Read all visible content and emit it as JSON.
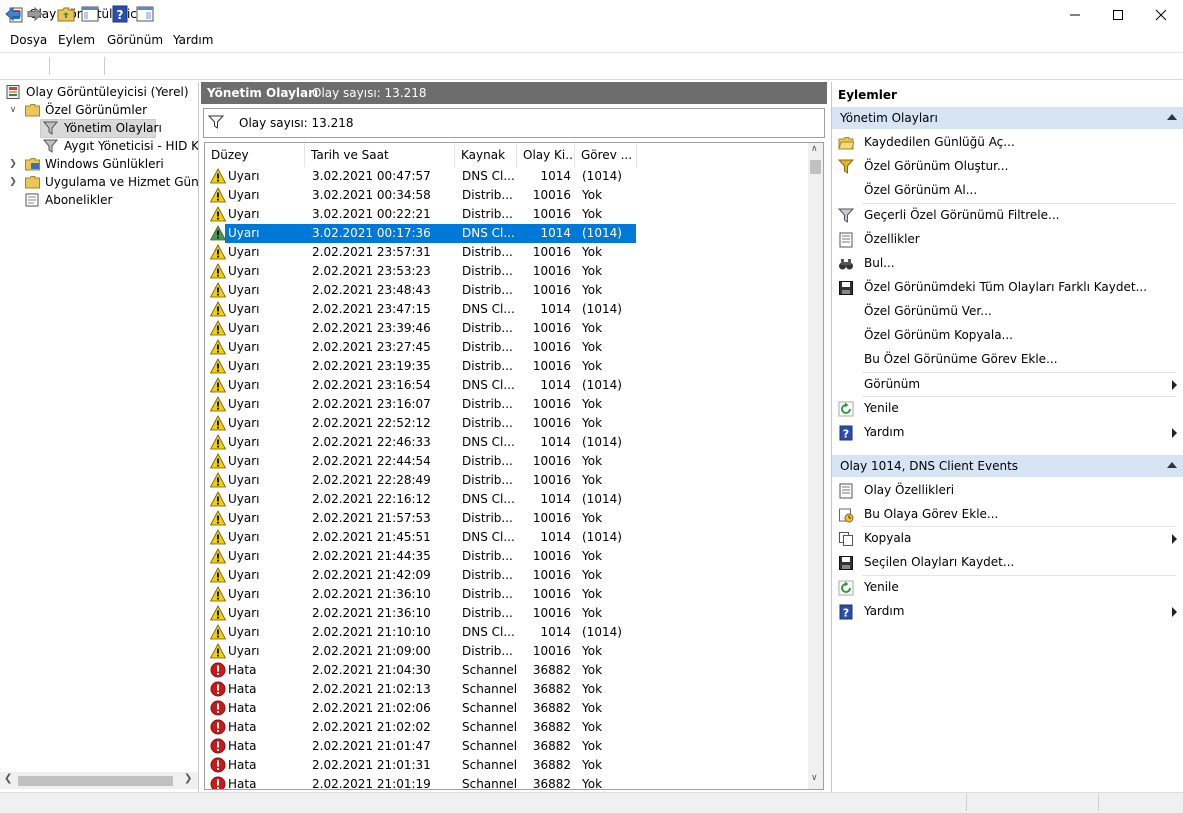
{
  "window": {
    "title": "Olay Görüntüleyicisi"
  },
  "menu": [
    {
      "label": "Dosya"
    },
    {
      "label": "Eylem"
    },
    {
      "label": "Görünüm"
    },
    {
      "label": "Yardım"
    }
  ],
  "tree": {
    "items": [
      {
        "label": "Olay Görüntüleyicisi (Yerel)",
        "icon": "event-viewer-icon"
      },
      {
        "label": "Özel Görünümler",
        "icon": "folder-icon"
      },
      {
        "label": "Yönetim Olayları",
        "icon": "filter-icon"
      },
      {
        "label": "Aygıt Yöneticisi - HID Kla",
        "icon": "filter-icon"
      },
      {
        "label": "Windows Günlükleri",
        "icon": "folder-icon"
      },
      {
        "label": "Uygulama ve Hizmet Günlük",
        "icon": "folder-icon"
      },
      {
        "label": "Abonelikler",
        "icon": "subscriptions-icon"
      }
    ]
  },
  "center": {
    "title": "Yönetim Olayları",
    "count_label": "Olay sayısı: 13.218",
    "filter_count": "Olay sayısı: 13.218",
    "columns": [
      "Düzey",
      "Tarih ve Saat",
      "Kaynak",
      "Olay Ki...",
      "Görev ..."
    ],
    "rows": [
      {
        "level": "Uyarı",
        "type": "warning",
        "date": "3.02.2021 00:47:57",
        "source": "DNS Cl...",
        "id": "1014",
        "task": "(1014)"
      },
      {
        "level": "Uyarı",
        "type": "warning",
        "date": "3.02.2021 00:34:58",
        "source": "Distrib...",
        "id": "10016",
        "task": "Yok"
      },
      {
        "level": "Uyarı",
        "type": "warning",
        "date": "3.02.2021 00:22:21",
        "source": "Distrib...",
        "id": "10016",
        "task": "Yok"
      },
      {
        "level": "Uyarı",
        "type": "warning",
        "date": "3.02.2021 00:17:36",
        "source": "DNS Cl...",
        "id": "1014",
        "task": "(1014)",
        "selected": true
      },
      {
        "level": "Uyarı",
        "type": "warning",
        "date": "2.02.2021 23:57:31",
        "source": "Distrib...",
        "id": "10016",
        "task": "Yok"
      },
      {
        "level": "Uyarı",
        "type": "warning",
        "date": "2.02.2021 23:53:23",
        "source": "Distrib...",
        "id": "10016",
        "task": "Yok"
      },
      {
        "level": "Uyarı",
        "type": "warning",
        "date": "2.02.2021 23:48:43",
        "source": "Distrib...",
        "id": "10016",
        "task": "Yok"
      },
      {
        "level": "Uyarı",
        "type": "warning",
        "date": "2.02.2021 23:47:15",
        "source": "DNS Cl...",
        "id": "1014",
        "task": "(1014)"
      },
      {
        "level": "Uyarı",
        "type": "warning",
        "date": "2.02.2021 23:39:46",
        "source": "Distrib...",
        "id": "10016",
        "task": "Yok"
      },
      {
        "level": "Uyarı",
        "type": "warning",
        "date": "2.02.2021 23:27:45",
        "source": "Distrib...",
        "id": "10016",
        "task": "Yok"
      },
      {
        "level": "Uyarı",
        "type": "warning",
        "date": "2.02.2021 23:19:35",
        "source": "Distrib...",
        "id": "10016",
        "task": "Yok"
      },
      {
        "level": "Uyarı",
        "type": "warning",
        "date": "2.02.2021 23:16:54",
        "source": "DNS Cl...",
        "id": "1014",
        "task": "(1014)"
      },
      {
        "level": "Uyarı",
        "type": "warning",
        "date": "2.02.2021 23:16:07",
        "source": "Distrib...",
        "id": "10016",
        "task": "Yok"
      },
      {
        "level": "Uyarı",
        "type": "warning",
        "date": "2.02.2021 22:52:12",
        "source": "Distrib...",
        "id": "10016",
        "task": "Yok"
      },
      {
        "level": "Uyarı",
        "type": "warning",
        "date": "2.02.2021 22:46:33",
        "source": "DNS Cl...",
        "id": "1014",
        "task": "(1014)"
      },
      {
        "level": "Uyarı",
        "type": "warning",
        "date": "2.02.2021 22:44:54",
        "source": "Distrib...",
        "id": "10016",
        "task": "Yok"
      },
      {
        "level": "Uyarı",
        "type": "warning",
        "date": "2.02.2021 22:28:49",
        "source": "Distrib...",
        "id": "10016",
        "task": "Yok"
      },
      {
        "level": "Uyarı",
        "type": "warning",
        "date": "2.02.2021 22:16:12",
        "source": "DNS Cl...",
        "id": "1014",
        "task": "(1014)"
      },
      {
        "level": "Uyarı",
        "type": "warning",
        "date": "2.02.2021 21:57:53",
        "source": "Distrib...",
        "id": "10016",
        "task": "Yok"
      },
      {
        "level": "Uyarı",
        "type": "warning",
        "date": "2.02.2021 21:45:51",
        "source": "DNS Cl...",
        "id": "1014",
        "task": "(1014)"
      },
      {
        "level": "Uyarı",
        "type": "warning",
        "date": "2.02.2021 21:44:35",
        "source": "Distrib...",
        "id": "10016",
        "task": "Yok"
      },
      {
        "level": "Uyarı",
        "type": "warning",
        "date": "2.02.2021 21:42:09",
        "source": "Distrib...",
        "id": "10016",
        "task": "Yok"
      },
      {
        "level": "Uyarı",
        "type": "warning",
        "date": "2.02.2021 21:36:10",
        "source": "Distrib...",
        "id": "10016",
        "task": "Yok"
      },
      {
        "level": "Uyarı",
        "type": "warning",
        "date": "2.02.2021 21:36:10",
        "source": "Distrib...",
        "id": "10016",
        "task": "Yok"
      },
      {
        "level": "Uyarı",
        "type": "warning",
        "date": "2.02.2021 21:10:10",
        "source": "DNS Cl...",
        "id": "1014",
        "task": "(1014)"
      },
      {
        "level": "Uyarı",
        "type": "warning",
        "date": "2.02.2021 21:09:00",
        "source": "Distrib...",
        "id": "10016",
        "task": "Yok"
      },
      {
        "level": "Hata",
        "type": "error",
        "date": "2.02.2021 21:04:30",
        "source": "Schannel",
        "id": "36882",
        "task": "Yok"
      },
      {
        "level": "Hata",
        "type": "error",
        "date": "2.02.2021 21:02:13",
        "source": "Schannel",
        "id": "36882",
        "task": "Yok"
      },
      {
        "level": "Hata",
        "type": "error",
        "date": "2.02.2021 21:02:06",
        "source": "Schannel",
        "id": "36882",
        "task": "Yok"
      },
      {
        "level": "Hata",
        "type": "error",
        "date": "2.02.2021 21:02:02",
        "source": "Schannel",
        "id": "36882",
        "task": "Yok"
      },
      {
        "level": "Hata",
        "type": "error",
        "date": "2.02.2021 21:01:47",
        "source": "Schannel",
        "id": "36882",
        "task": "Yok"
      },
      {
        "level": "Hata",
        "type": "error",
        "date": "2.02.2021 21:01:31",
        "source": "Schannel",
        "id": "36882",
        "task": "Yok"
      },
      {
        "level": "Hata",
        "type": "error",
        "date": "2.02.2021 21:01:19",
        "source": "Schannel",
        "id": "36882",
        "task": "Yok"
      }
    ]
  },
  "actions": {
    "title": "Eylemler",
    "sections": [
      {
        "label": "Yönetim Olayları",
        "items": [
          {
            "label": "Kaydedilen Günlüğü Aç...",
            "icon": "open-folder-icon"
          },
          {
            "label": "Özel Görünüm Oluştur...",
            "icon": "filter-create-icon"
          },
          {
            "label": "Özel Görünüm Al...",
            "icon": ""
          },
          {
            "label": "Geçerli Özel Görünümü Filtrele...",
            "icon": "filter-icon"
          },
          {
            "label": "Özellikler",
            "icon": "properties-icon"
          },
          {
            "label": "Bul...",
            "icon": "binoculars-icon"
          },
          {
            "label": "Özel Görünümdeki Tüm Olayları Farklı Kaydet...",
            "icon": "save-icon"
          },
          {
            "label": "Özel Görünümü Ver...",
            "icon": ""
          },
          {
            "label": "Özel Görünüm Kopyala...",
            "icon": ""
          },
          {
            "label": "Bu Özel Görünüme Görev Ekle...",
            "icon": ""
          },
          {
            "label": "Görünüm",
            "icon": "",
            "submenu": true
          },
          {
            "label": "Yenile",
            "icon": "refresh-icon"
          },
          {
            "label": "Yardım",
            "icon": "help-icon",
            "submenu": true
          }
        ]
      },
      {
        "label": "Olay 1014, DNS Client Events",
        "items": [
          {
            "label": "Olay Özellikleri",
            "icon": "properties-icon"
          },
          {
            "label": "Bu Olaya Görev Ekle...",
            "icon": "task-icon"
          },
          {
            "label": "Kopyala",
            "icon": "copy-icon",
            "submenu": true
          },
          {
            "label": "Seçilen Olayları Kaydet...",
            "icon": "save-icon"
          },
          {
            "label": "Yenile",
            "icon": "refresh-icon"
          },
          {
            "label": "Yardım",
            "icon": "help-icon",
            "submenu": true
          }
        ]
      }
    ]
  },
  "colors": {
    "selection": "#0078d7",
    "section_header": "#d6e4f4",
    "center_header": "#6d6d6d"
  }
}
